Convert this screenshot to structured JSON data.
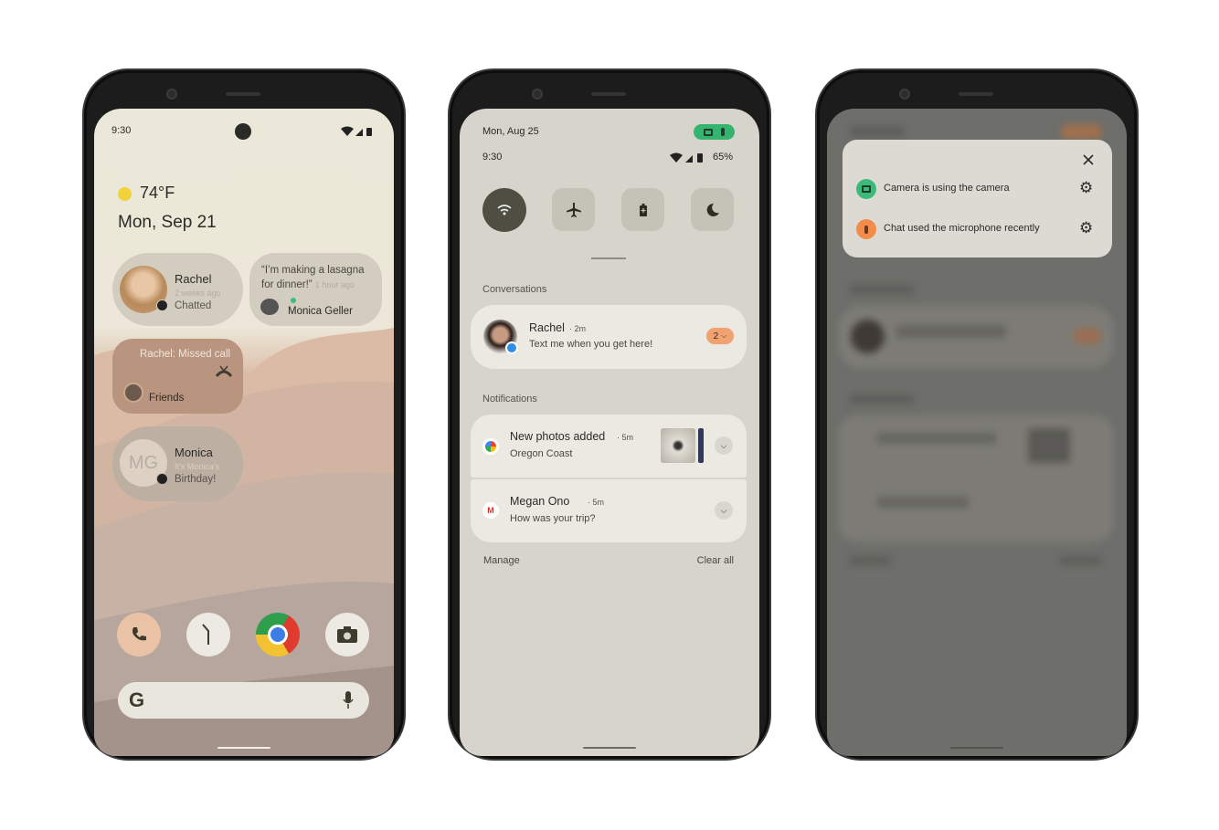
{
  "home_screen": {
    "status_time": "9:30",
    "weather": {
      "temp": "74°F",
      "icon": "sun-icon"
    },
    "date": "Mon, Sep 21",
    "widgets": [
      {
        "name": "Rachel",
        "time": "2 weeks ago",
        "status": "Chatted",
        "badge_icon": "messenger-icon"
      },
      {
        "quote": "“I’m making a lasagna for dinner!”",
        "time": "1 hour ago",
        "name": "Monica Geller"
      },
      {
        "title": "Rachel: Missed call",
        "group": "Friends",
        "icon": "missed-call-icon"
      },
      {
        "initials": "MG",
        "name": "Monica",
        "line1": "It's Monica's",
        "line2": "Birthday!"
      }
    ],
    "dock": [
      "phone-icon",
      "clock-icon",
      "chrome-icon",
      "camera-icon"
    ],
    "search": {
      "logo": "G",
      "mic_icon": "mic-icon"
    }
  },
  "shade": {
    "date": "Mon, Aug 25",
    "time": "9:30",
    "battery": "65%",
    "privacy_chip_color": "#34b46e",
    "tiles": [
      {
        "icon": "wifi-icon",
        "active": true
      },
      {
        "icon": "airplane-icon",
        "active": false
      },
      {
        "icon": "battery-saver-icon",
        "active": false
      },
      {
        "icon": "moon-icon",
        "active": false
      }
    ],
    "conversations_label": "Conversations",
    "conversation": {
      "name": "Rachel",
      "time": "2m",
      "message": "Text me when you get here!",
      "count": "2"
    },
    "notifications_label": "Notifications",
    "notifications": [
      {
        "title": "New photos added",
        "time": "5m",
        "text": "Oregon Coast",
        "app_icon": "google-photos-icon"
      },
      {
        "title": "Megan Ono",
        "time": "5m",
        "text": "How was your trip?",
        "app_icon": "gmail-icon"
      }
    ],
    "manage": "Manage",
    "clear_all": "Clear all"
  },
  "privacy_dialog": {
    "items": [
      {
        "text": "Camera is using the camera",
        "color": "#3cba7a",
        "icon": "camera-icon"
      },
      {
        "text": "Chat used the microphone recently",
        "color": "#f38b4a",
        "icon": "mic-icon"
      }
    ]
  }
}
